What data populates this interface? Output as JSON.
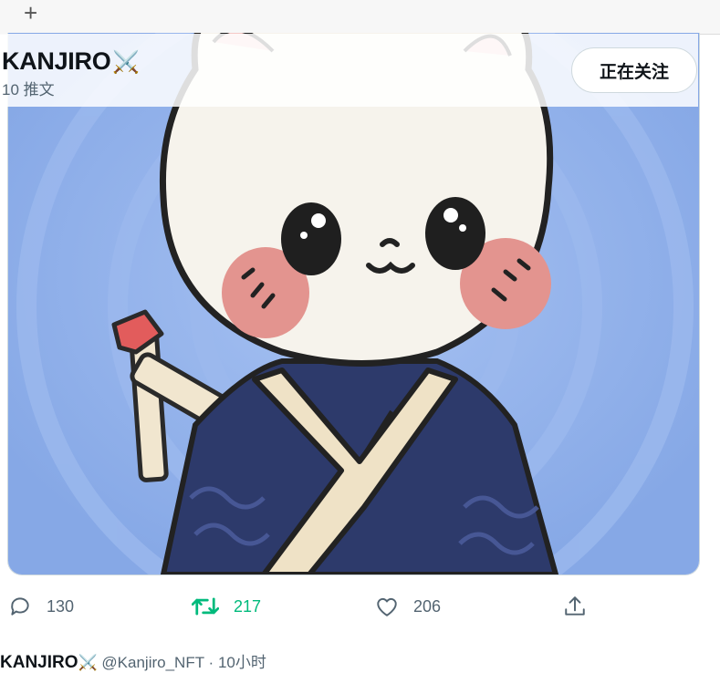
{
  "tab_strip": {
    "new_tab_icon": "plus-icon"
  },
  "profile_header": {
    "name": "KANJIRO",
    "name_emoji": "⚔️",
    "post_count": "10 推文",
    "follow_button_label": "正在关注"
  },
  "tweet_actions": {
    "replies": "130",
    "retweets": "217",
    "likes": "206"
  },
  "next_tweet": {
    "name": "KANJIRO",
    "name_emoji": "⚔️",
    "handle": "@Kanjiro_NFT",
    "separator": "·",
    "time": "10小时"
  },
  "colors": {
    "retweet_active": "#00ba7c",
    "muted_text": "#536471",
    "image_background": "#8fb0ea",
    "kimono": "#2d3a6b"
  }
}
